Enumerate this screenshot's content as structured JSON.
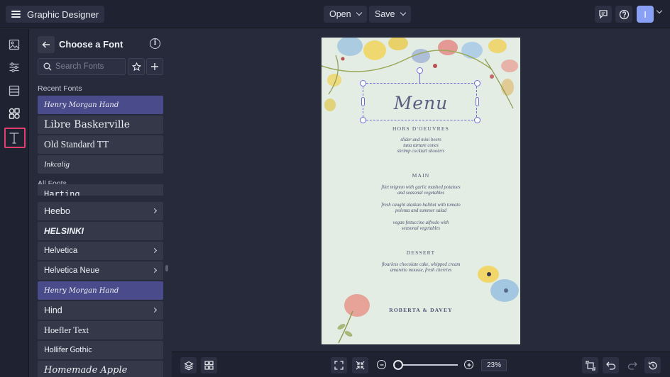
{
  "app": {
    "title": "Graphic Designer"
  },
  "toolbar": {
    "open_label": "Open",
    "save_label": "Save",
    "avatar_initial": "I"
  },
  "panel": {
    "title": "Choose a Font",
    "search_placeholder": "Search Fonts",
    "recent_label": "Recent Fonts",
    "all_label": "All Fonts",
    "recent_fonts": [
      "Henry Morgan Hand",
      "Libre Baskerville",
      "Old Standard TT",
      "Inkcalig"
    ],
    "all_fonts": [
      "Harting",
      "Heebo",
      "HELSINKI",
      "Helvetica",
      "Helvetica Neue",
      "Henry Morgan Hand",
      "Hind",
      "Hoefler Text",
      "Hollifer Gothic",
      "Homemade Apple"
    ]
  },
  "document": {
    "title": "Menu",
    "sections": [
      {
        "heading": "HORS D'OEUVRES",
        "items": [
          "slider and mini beers",
          "tuna tartare cones",
          "shrimp cocktail shooters"
        ]
      },
      {
        "heading": "MAIN",
        "items": [
          "filet mignon with garlic mashed potatoes",
          "and seasonal vegetables",
          "fresh caught alaskan halibut with tomato",
          "polenta and summer salad",
          "vegan fettuccine alfredo with",
          "seasonal vegetables"
        ]
      },
      {
        "heading": "DESSERT",
        "items": [
          "flourless chocolate cake, whipped cream",
          "amaretto mousse, fresh cherries"
        ]
      }
    ],
    "footer": "ROBERTA & DAVEY"
  },
  "zoom": {
    "value": "23%",
    "level": 0.06
  },
  "colors": {
    "accent": "#e33f6e",
    "selection": "#6b6bd6",
    "selected_font_bg": "#4a4b8a",
    "page_bg": "#e3ede4"
  }
}
